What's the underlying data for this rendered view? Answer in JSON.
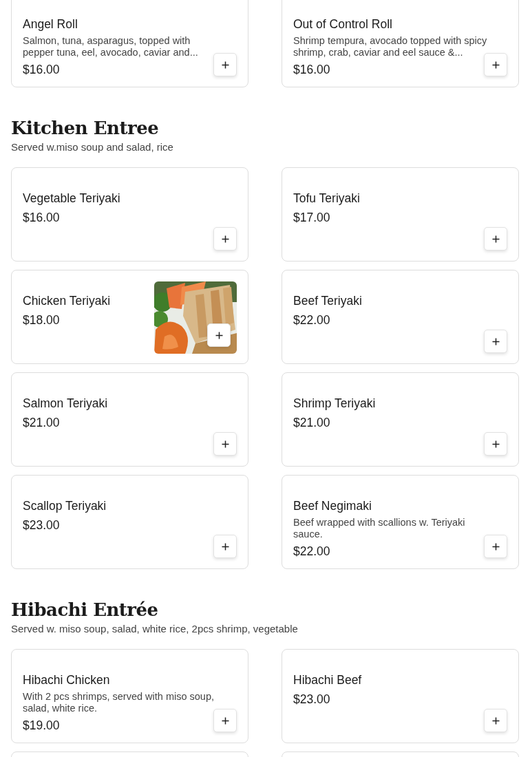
{
  "sections": [
    {
      "items": [
        {
          "name": "Angel Roll",
          "description": "Salmon, tuna, asparagus, topped with pepper tuna, eel, avocado, caviar and...",
          "price": "$16.00",
          "kind": "dish"
        },
        {
          "name": "Out of Control Roll",
          "description": "Shrimp tempura, avocado topped with spicy shrimp, crab, caviar and eel sauce &...",
          "price": "$16.00",
          "kind": "dish"
        }
      ]
    },
    {
      "title": "Kitchen Entree",
      "subtitle": "Served w.miso soup and salad, rice",
      "items": [
        {
          "name": "Vegetable Teriyaki",
          "price": "$16.00",
          "kind": "dish"
        },
        {
          "name": "Tofu Teriyaki",
          "price": "$17.00",
          "kind": "dish"
        },
        {
          "name": "Chicken Teriyaki",
          "price": "$18.00",
          "kind": "dish"
        },
        {
          "name": "Beef Teriyaki",
          "price": "$22.00",
          "kind": "dish"
        },
        {
          "name": "Salmon Teriyaki",
          "price": "$21.00",
          "kind": "dish"
        },
        {
          "name": "Shrimp Teriyaki",
          "price": "$21.00",
          "kind": "dish"
        },
        {
          "name": "Scallop Teriyaki",
          "price": "$23.00",
          "kind": "dish"
        },
        {
          "name": "Beef Negimaki",
          "description": "Beef wrapped with scallions w. Teriyaki sauce.",
          "price": "$22.00",
          "kind": "dish"
        }
      ]
    },
    {
      "title": "Hibachi Entrée",
      "subtitle": "Served w. miso soup, salad, white rice, 2pcs shrimp, vegetable",
      "items": [
        {
          "name": "Hibachi Chicken",
          "description": "With 2 pcs shrimps, served with miso soup, salad, white rice.",
          "price": "$19.00",
          "kind": "dish"
        },
        {
          "name": "Hibachi Beef",
          "price": "$23.00",
          "kind": "dish"
        },
        {
          "kind": "cut-off"
        },
        {
          "kind": "cut-off"
        }
      ]
    }
  ]
}
